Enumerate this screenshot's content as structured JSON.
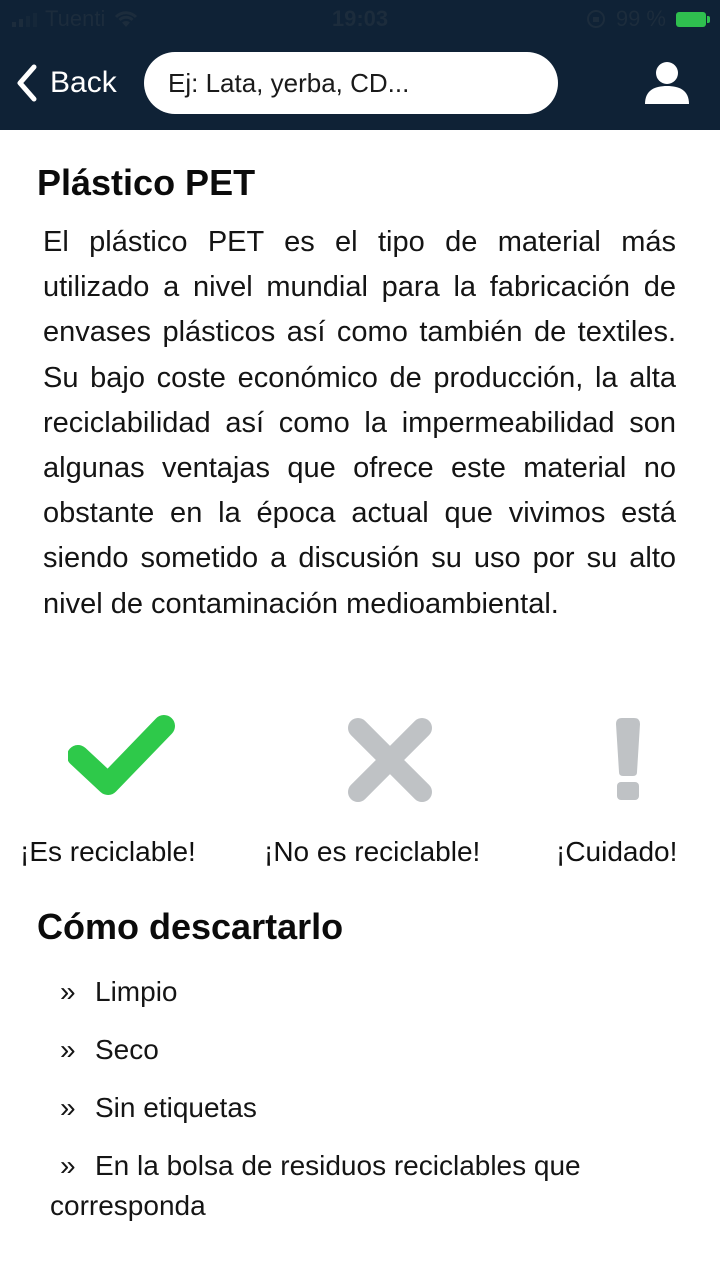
{
  "status_bar": {
    "carrier": "Tuenti",
    "time": "19:03",
    "battery": "99 %"
  },
  "nav": {
    "back_label": "Back",
    "search_placeholder": "Ej: Lata, yerba, CD...",
    "icons": {
      "back": "chevron-left-icon",
      "user": "user-icon"
    }
  },
  "material": {
    "title": "Plástico PET",
    "description": "El plástico PET es el tipo de material más utilizado a nivel mundial para la fabricación de envases plásticos así como también de textiles. Su bajo coste económico de producción, la alta reciclabilidad así como la impermeabilidad son algunas ventajas que ofrece este material no obstante en la época actual que vivimos está siendo sometido a discusión su uso por su alto nivel de contaminación medioambiental."
  },
  "status_options": [
    {
      "label": "¡Es reciclable!",
      "icon": "check-icon",
      "color": "#2ec94a",
      "active": true
    },
    {
      "label": "¡No es reciclable!",
      "icon": "cross-icon",
      "color": "#bfc2c5",
      "active": false
    },
    {
      "label": "¡Cuidado!",
      "icon": "exclamation-icon",
      "color": "#bfc2c5",
      "active": false
    }
  ],
  "disposal": {
    "title": "Cómo descartarlo",
    "bullet": "»",
    "steps": [
      "Limpio",
      "Seco",
      "Sin etiquetas",
      "En la bolsa de residuos reciclables que corresponda"
    ]
  },
  "colors": {
    "header_bg": "#0f2236",
    "accent_green": "#2ec94a",
    "inactive_gray": "#bfc2c5"
  }
}
